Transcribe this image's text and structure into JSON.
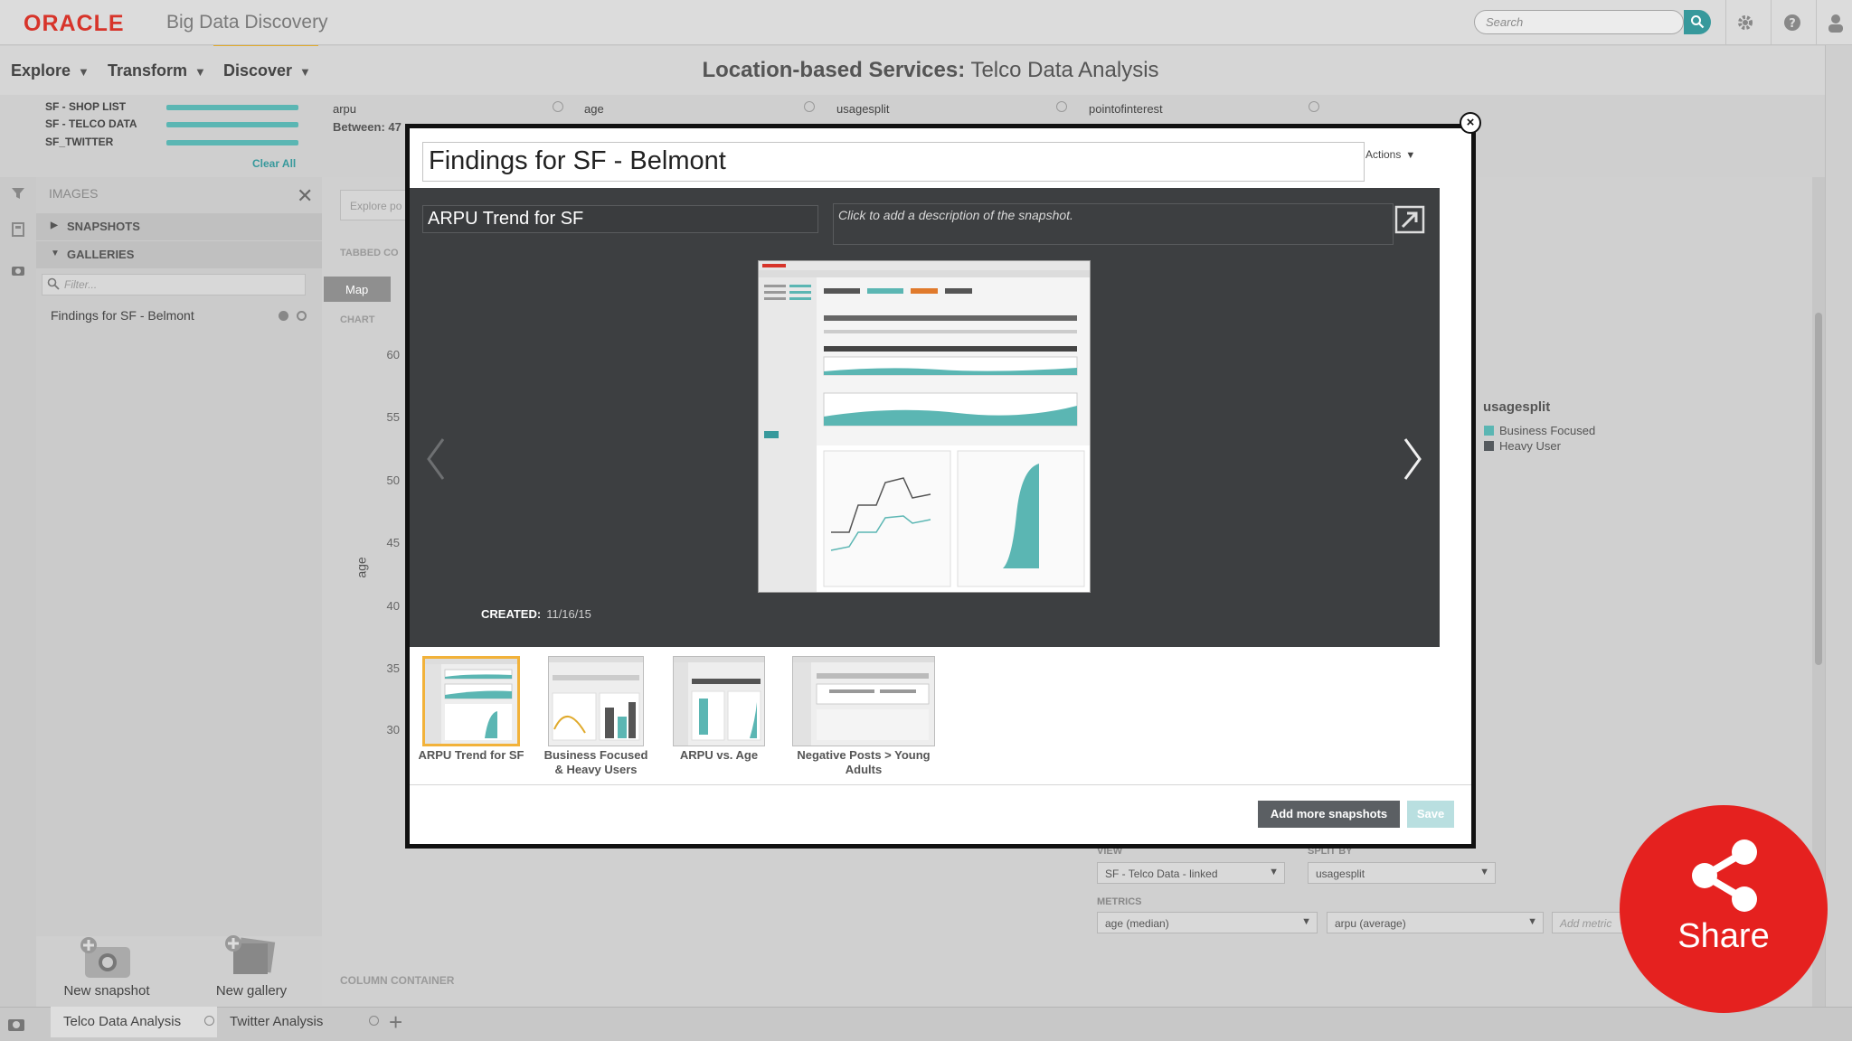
{
  "app": {
    "logo": "ORACLE",
    "product": "Big Data Discovery",
    "search_placeholder": "Search"
  },
  "nav": {
    "items": [
      {
        "label": "Explore"
      },
      {
        "label": "Transform"
      },
      {
        "label": "Discover"
      }
    ],
    "project_title": "Location-based Services:",
    "page_title": "Telco Data Analysis"
  },
  "datasets": {
    "items": [
      "SF - SHOP LIST",
      "SF - TELCO DATA",
      "SF_TWITTER"
    ],
    "clear_all": "Clear All"
  },
  "facets": [
    {
      "label": "arpu",
      "sub": "Between: 47"
    },
    {
      "label": "age",
      "sub": ""
    },
    {
      "label": "usagesplit",
      "sub": ""
    },
    {
      "label": "pointofinterest",
      "sub": ""
    }
  ],
  "left_panel": {
    "title": "IMAGES",
    "snapshots": "SNAPSHOTS",
    "galleries": "GALLERIES",
    "filter_placeholder": "Filter...",
    "gallery_item": "Findings for SF - Belmont",
    "new_snapshot": "New snapshot",
    "new_gallery": "New gallery"
  },
  "background": {
    "explore_text": "Explore po",
    "tabbed_label": "TABBED CO",
    "map_tab": "Map",
    "chart_label": "CHART",
    "y_ticks": [
      "60",
      "55",
      "50",
      "45",
      "40",
      "35",
      "30"
    ],
    "y_label": "age",
    "legend": {
      "title": "usagesplit",
      "items": [
        {
          "label": "Business Focused",
          "color": "#5bb6b3"
        },
        {
          "label": "Heavy User",
          "color": "#555a5e"
        }
      ]
    },
    "config": {
      "view_label": "VIEW",
      "view_value": "SF - Telco Data - linked",
      "split_label": "SPLIT BY",
      "split_value": "usagesplit",
      "metrics_label": "METRICS",
      "metric1": "age (median)",
      "metric2": "arpu (average)",
      "add_metric": "Add metric"
    },
    "column_container": "COLUMN CONTAINER"
  },
  "bottom_tabs": [
    {
      "label": "Telco Data Analysis",
      "active": true
    },
    {
      "label": "Twitter Analysis",
      "active": false
    }
  ],
  "modal": {
    "gallery_title": "Findings for SF - Belmont",
    "actions_label": "Actions",
    "snapshot_title": "ARPU Trend for SF",
    "description_placeholder": "Click to add a description of the snapshot.",
    "created_label": "CREATED:",
    "created_date": "11/16/15",
    "thumbnails": [
      {
        "label": "ARPU Trend for SF",
        "selected": true
      },
      {
        "label": "Business Focused & Heavy Users",
        "selected": false
      },
      {
        "label": "ARPU vs. Age",
        "selected": false
      },
      {
        "label": "Negative Posts > Young Adults",
        "selected": false
      }
    ],
    "add_more_label": "Add more snapshots",
    "save_label": "Save"
  },
  "share": {
    "label": "Share",
    "color": "#e5211f"
  },
  "colors": {
    "accent_teal": "#37999c",
    "oracle_red": "#d7342a",
    "selection_orange": "#f2b23a"
  }
}
